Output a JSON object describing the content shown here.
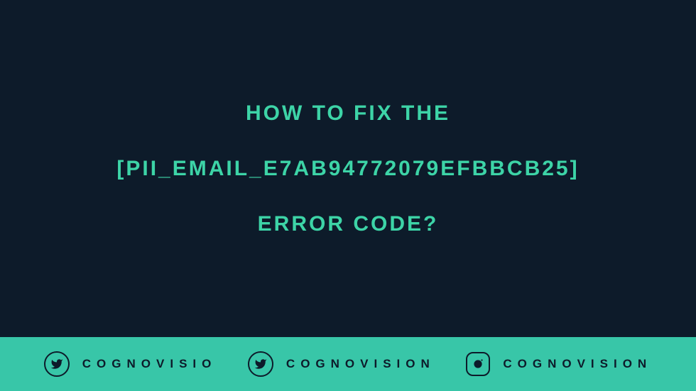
{
  "heading": {
    "line1": "HOW TO FIX THE",
    "line2": "[PII_EMAIL_E7AB94772079EFBBCB25]",
    "line3": "ERROR CODE?"
  },
  "footer": {
    "items": [
      {
        "icon": "twitter",
        "label": "COGNOVISIO"
      },
      {
        "icon": "twitter",
        "label": "COGNOVISION"
      },
      {
        "icon": "instagram",
        "label": "COGNOVISION"
      }
    ]
  },
  "colors": {
    "background": "#0d1b2a",
    "accent": "#3dd4a7",
    "footer_bg": "#38c6a8",
    "footer_fg": "#0d1b2a"
  }
}
